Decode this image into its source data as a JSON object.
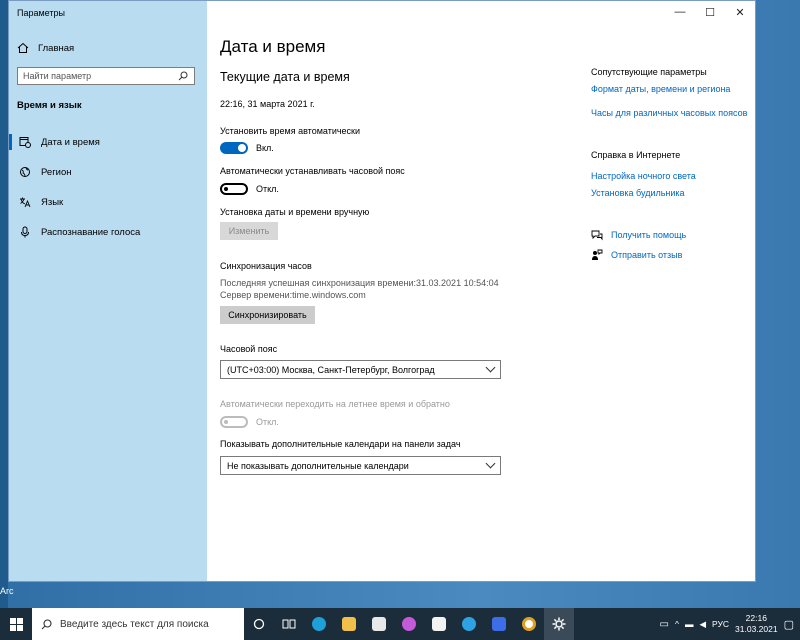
{
  "window": {
    "title": "Параметры",
    "minimize": "—",
    "maximize": "☐",
    "close": "✕"
  },
  "sidebar": {
    "home": "Главная",
    "search_placeholder": "Найти параметр",
    "section": "Время и язык",
    "items": [
      {
        "label": "Дата и время",
        "icon": "calendar-clock-icon",
        "active": true
      },
      {
        "label": "Регион",
        "icon": "globe-icon",
        "active": false
      },
      {
        "label": "Язык",
        "icon": "language-icon",
        "active": false
      },
      {
        "label": "Распознавание голоса",
        "icon": "microphone-icon",
        "active": false
      }
    ]
  },
  "main": {
    "title": "Дата и время",
    "current_header": "Текущие дата и время",
    "current_datetime": "22:16, 31 марта 2021 г.",
    "auto_time": {
      "label": "Установить время автоматически",
      "state": "Вкл."
    },
    "auto_tz": {
      "label": "Автоматически устанавливать часовой пояс",
      "state": "Откл."
    },
    "manual": {
      "label": "Установка даты и времени вручную",
      "button": "Изменить"
    },
    "sync": {
      "header": "Синхронизация часов",
      "last": "Последняя успешная синхронизация времени:31.03.2021 10:54:04",
      "server": "Сервер времени:time.windows.com",
      "button": "Синхронизировать"
    },
    "timezone": {
      "label": "Часовой пояс",
      "value": "(UTC+03:00) Москва, Санкт-Петербург, Волгоград"
    },
    "dst": {
      "label": "Автоматически переходить на летнее время и обратно",
      "state": "Откл."
    },
    "calendars": {
      "label": "Показывать дополнительные календари на панели задач",
      "value": "Не показывать дополнительные календари"
    }
  },
  "related": {
    "header": "Сопутствующие параметры",
    "links": [
      "Формат даты, времени и региона",
      "Часы для различных часовых поясов"
    ],
    "web_header": "Справка в Интернете",
    "web_links": [
      "Настройка ночного света",
      "Установка будильника"
    ],
    "help": "Получить помощь",
    "feedback": "Отправить отзыв"
  },
  "desktop": {
    "icon_text": "Arc"
  },
  "taskbar": {
    "search_placeholder": "Введите здесь текст для поиска",
    "language": "РУС",
    "time": "22:16",
    "date": "31.03.2021"
  },
  "colors": {
    "accent": "#0067c0",
    "sidebar": "#b9dcf0",
    "taskbar": "#1b2c3b"
  }
}
